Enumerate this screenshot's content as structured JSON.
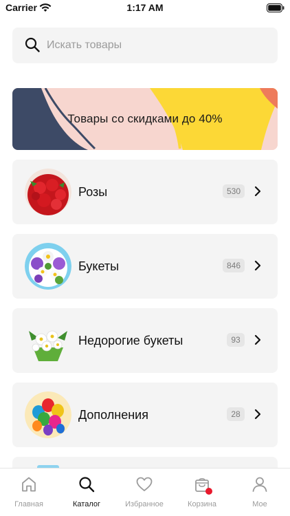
{
  "status_bar": {
    "carrier": "Carrier",
    "time": "1:17 AM"
  },
  "search": {
    "placeholder": "Искать товары",
    "icon": "search-icon"
  },
  "promo": {
    "text": "Товары со скидками до 40%",
    "colors": {
      "background": "#f7d6cf",
      "navy": "#3d4a66",
      "yellow": "#fcd836"
    }
  },
  "categories": [
    {
      "label": "Розы",
      "count": "530",
      "icon": "roses-image"
    },
    {
      "label": "Букеты",
      "count": "846",
      "icon": "bouquet-image"
    },
    {
      "label": "Недорогие букеты",
      "count": "93",
      "icon": "cheap-bouquet-image"
    },
    {
      "label": "Дополнения",
      "count": "28",
      "icon": "balloons-image"
    }
  ],
  "tabbar": {
    "tabs": [
      {
        "label": "Главная",
        "icon": "home-icon",
        "active": false
      },
      {
        "label": "Каталог",
        "icon": "search-icon",
        "active": true
      },
      {
        "label": "Избранное",
        "icon": "heart-icon",
        "active": false
      },
      {
        "label": "Корзина",
        "icon": "bag-icon",
        "active": false,
        "badge_dot": true
      },
      {
        "label": "Мое",
        "icon": "person-icon",
        "active": false
      }
    ],
    "colors": {
      "active": "#111111",
      "inactive": "#9b9b9b",
      "badge": "#e8192c"
    }
  }
}
